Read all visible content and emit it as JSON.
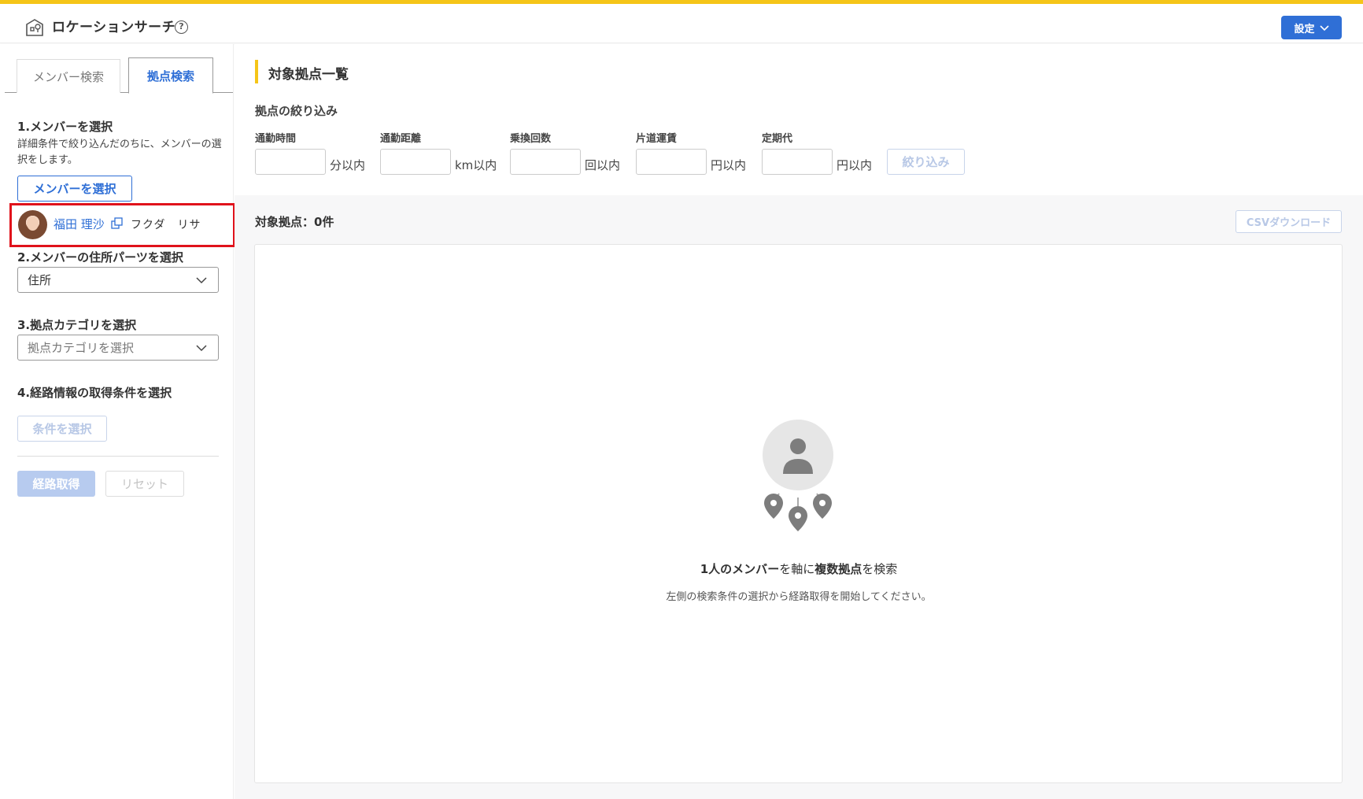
{
  "header": {
    "title": "ロケーションサーチ",
    "help_icon": "?",
    "settings_label": "設定"
  },
  "sidebar": {
    "tabs": [
      {
        "label": "メンバー検索",
        "active": false
      },
      {
        "label": "拠点検索",
        "active": true
      }
    ],
    "step1": {
      "title": "1.メンバーを選択",
      "description": "詳細条件で絞り込んだのちに、メンバーの選択をします。",
      "button_label": "メンバーを選択"
    },
    "member": {
      "name": "福田 理沙",
      "kana": "フクダ　リサ"
    },
    "step2": {
      "title": "2.メンバーの住所パーツを選択",
      "selected": "住所"
    },
    "step3": {
      "title": "3.拠点カテゴリを選択",
      "placeholder": "拠点カテゴリを選択"
    },
    "step4": {
      "title": "4.経路情報の取得条件を選択",
      "button_label": "条件を選択"
    },
    "actions": {
      "get_route_label": "経路取得",
      "reset_label": "リセット"
    }
  },
  "main": {
    "title": "対象拠点一覧",
    "filter": {
      "title": "拠点の絞り込み",
      "fields": [
        {
          "label": "通勤時間",
          "unit": "分以内",
          "value": ""
        },
        {
          "label": "通勤距離",
          "unit": "km以内",
          "value": ""
        },
        {
          "label": "乗換回数",
          "unit": "回以内",
          "value": ""
        },
        {
          "label": "片道運賃",
          "unit": "円以内",
          "value": ""
        },
        {
          "label": "定期代",
          "unit": "円以内",
          "value": ""
        }
      ],
      "button_label": "絞り込み"
    },
    "count_label": "対象拠点：0件",
    "csv_label": "CSVダウンロード",
    "empty": {
      "msg_1": "1人のメンバー",
      "msg_2": "を軸に",
      "msg_3": "複数拠点",
      "msg_4": "を検索",
      "sub": "左側の検索条件の選択から経路取得を開始してください。"
    }
  },
  "colors": {
    "accent": "#2f6fd6",
    "highlight": "#f5c518",
    "selection_border": "#e0121b"
  }
}
